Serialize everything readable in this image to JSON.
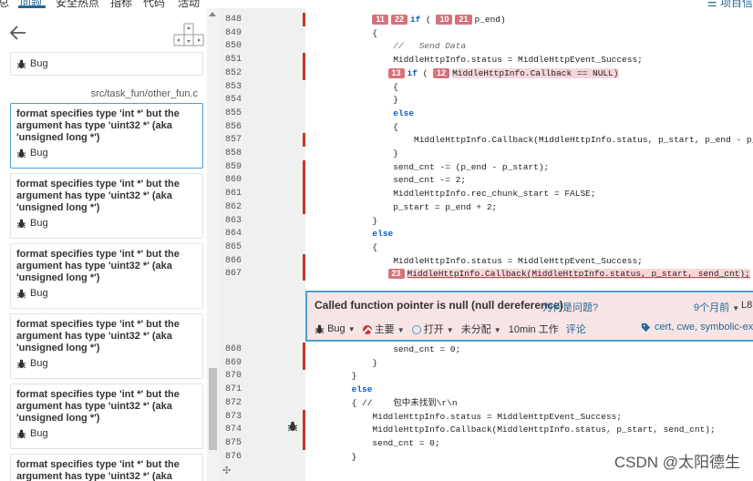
{
  "topnav": {
    "tabs": [
      "总",
      "问题",
      "安全热点",
      "指标",
      "代码",
      "活动"
    ],
    "active": "问题",
    "project_info": "项目信"
  },
  "left_panel": {
    "first_card_type": "Bug",
    "file_path": "src/task_fun/other_fun.c",
    "issues": [
      {
        "message": "format specifies type 'int *' but the argument has type 'uint32 *' (aka 'unsigned long *')",
        "type": "Bug"
      },
      {
        "message": "format specifies type 'int *' but the argument has type 'uint32 *' (aka 'unsigned long *')",
        "type": "Bug"
      },
      {
        "message": "format specifies type 'int *' but the argument has type 'uint32 *' (aka 'unsigned long *')",
        "type": "Bug"
      },
      {
        "message": "format specifies type 'int *' but the argument has type 'uint32 *' (aka 'unsigned long *')",
        "type": "Bug"
      },
      {
        "message": "format specifies type 'int *' but the argument has type 'uint32 *' (aka 'unsigned long *')",
        "type": "Bug"
      },
      {
        "message": "format specifies type 'int *' but the argument has type 'uint32 *' (aka",
        "type": ""
      }
    ]
  },
  "code": {
    "lines_top": [
      {
        "n": "848",
        "text": "if ( ",
        "tail": "p_end)",
        "badges": [
          "11",
          "22"
        ],
        "badges2": [
          "10",
          "21"
        ],
        "indent": "            ",
        "marker": true
      },
      {
        "n": "849",
        "text": "            {",
        "marker": false
      },
      {
        "n": "850",
        "text": "                //   Send Data",
        "comment": true,
        "marker": false
      },
      {
        "n": "851",
        "text": "                MiddleHttpInfo.status = MiddleHttpEvent_Success;",
        "marker": true
      },
      {
        "n": "852",
        "text": "MiddleHttpInfo.Callback == NULL)",
        "marker": true
      },
      {
        "n": "853",
        "text": "                {",
        "marker": false
      },
      {
        "n": "854",
        "text": "                }",
        "marker": false
      },
      {
        "n": "855",
        "text": "                else",
        "marker": false
      },
      {
        "n": "856",
        "text": "                {",
        "marker": false
      },
      {
        "n": "857",
        "text": "                    MiddleHttpInfo.Callback(MiddleHttpInfo.status, p_start, p_end - p_star",
        "marker": true
      },
      {
        "n": "858",
        "text": "                }",
        "marker": false
      },
      {
        "n": "859",
        "text": "                send_cnt -= (p_end - p_start);",
        "marker": true
      },
      {
        "n": "860",
        "text": "                send_cnt -= 2;",
        "marker": true
      },
      {
        "n": "861",
        "text": "                MiddleHttpInfo.rec_chunk_start = FALSE;",
        "marker": true
      },
      {
        "n": "862",
        "text": "                p_start = p_end + 2;",
        "marker": true
      },
      {
        "n": "863",
        "text": "            }",
        "marker": false
      },
      {
        "n": "864",
        "text": "            else",
        "marker": false
      },
      {
        "n": "865",
        "text": "            {",
        "marker": false
      },
      {
        "n": "866",
        "text": "                MiddleHttpInfo.status = MiddleHttpEvent_Success;",
        "marker": true
      },
      {
        "n": "867",
        "text": "MiddleHttpInfo.Callback(MiddleHttpInfo.status, p_start, send_cnt);",
        "marker": true
      }
    ],
    "lines_bottom": [
      {
        "n": "868",
        "text": "                send_cnt = 0;",
        "marker": true
      },
      {
        "n": "869",
        "text": "            }",
        "marker": true
      },
      {
        "n": "870",
        "text": "        }",
        "marker": false
      },
      {
        "n": "871",
        "text": "        else",
        "marker": false
      },
      {
        "n": "872",
        "text": "        { //    包中未找到\\r\\n",
        "marker": false
      },
      {
        "n": "873",
        "text": "            MiddleHttpInfo.status = MiddleHttpEvent_Success;",
        "marker": true
      },
      {
        "n": "874",
        "text": "            MiddleHttpInfo.Callback(MiddleHttpInfo.status, p_start, send_cnt);",
        "marker": true
      },
      {
        "n": "875",
        "text": "            send_cnt = 0;",
        "marker": true
      },
      {
        "n": "876",
        "text": "        }",
        "marker": false
      }
    ],
    "line852_badges": [
      "13",
      "12"
    ],
    "line867_badge": "23"
  },
  "issue": {
    "title": "Called function pointer is null (null dereference)",
    "why": "为何是问题?",
    "ago": "9个月前",
    "line_ref": "L8",
    "type": "Bug",
    "severity": "主要",
    "status": "打开",
    "assignee": "未分配",
    "effort": "10min 工作",
    "comment": "评论",
    "tags": "cert, cwe, symbolic-execu"
  },
  "watermark": "CSDN @太阳德生"
}
